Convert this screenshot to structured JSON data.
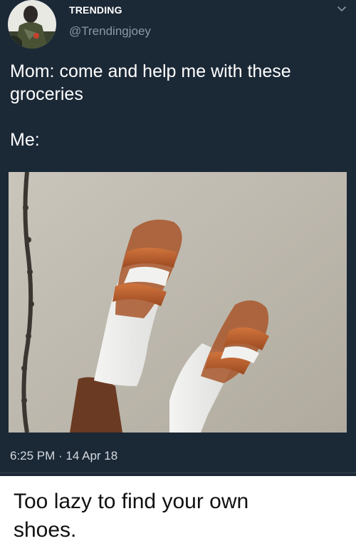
{
  "tweet": {
    "display_name": "TRENDING",
    "handle": "@Trendingjoey",
    "text_lines": [
      "Mom: come and help me with these",
      "groceries"
    ],
    "text_second": "Me:",
    "timestamp": "6:25 PM · 14 Apr 18",
    "avatar_icon": "avatar-photo",
    "menu_icon": "chevron-down-icon"
  },
  "caption": {
    "line1": "Too lazy to find your own",
    "line2": "shoes."
  },
  "colors": {
    "tweet_background": "#1b2836",
    "handle_color": "#8899a6",
    "page_background": "#ffffff"
  }
}
